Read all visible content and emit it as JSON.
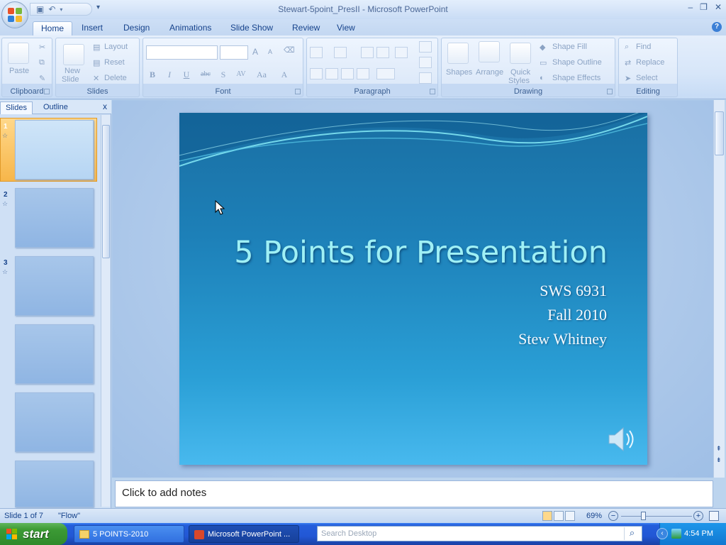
{
  "window": {
    "title": "Stewart-5point_PresII - Microsoft PowerPoint"
  },
  "tabs": [
    "Home",
    "Insert",
    "Design",
    "Animations",
    "Slide Show",
    "Review",
    "View"
  ],
  "ribbon": {
    "clipboard": {
      "title": "Clipboard",
      "paste": "Paste"
    },
    "slides": {
      "title": "Slides",
      "new_slide": "New",
      "new_slide2": "Slide",
      "layout": "Layout",
      "reset": "Reset",
      "delete": "Delete"
    },
    "font": {
      "title": "Font",
      "bold": "B",
      "italic": "I",
      "underline": "U",
      "strike": "abc",
      "shadow": "S",
      "spacing": "AV",
      "case": "Aa",
      "color": "A",
      "grow": "A",
      "shrink": "A"
    },
    "paragraph": {
      "title": "Paragraph"
    },
    "drawing": {
      "title": "Drawing",
      "shapes": "Shapes",
      "arrange": "Arrange",
      "quick_styles": "Quick",
      "quick_styles2": "Styles",
      "shape_fill": "Shape Fill",
      "shape_outline": "Shape Outline",
      "shape_effects": "Shape Effects"
    },
    "editing": {
      "title": "Editing",
      "find": "Find",
      "replace": "Replace",
      "select": "Select"
    }
  },
  "panel": {
    "tab_slides": "Slides",
    "tab_outline": "Outline",
    "close": "x",
    "thumbs": [
      "1",
      "2",
      "3"
    ]
  },
  "slide": {
    "title": "5 Points for Presentation",
    "lines": [
      "SWS 6931",
      "Fall 2010",
      "Stew Whitney"
    ]
  },
  "notes": {
    "placeholder": "Click to add notes"
  },
  "status": {
    "slide_info": "Slide 1 of 7",
    "theme": "\"Flow\"",
    "zoom": "69%"
  },
  "taskbar": {
    "start": "start",
    "tasks": [
      "5 POINTS-2010",
      "Microsoft PowerPoint ..."
    ],
    "search_placeholder": "Search Desktop",
    "clock": "4:54 PM"
  },
  "colors": {
    "ribbon_text": "#15428b",
    "slide_title": "#9ff0f5",
    "taskbar_blue": "#245edb",
    "start_green": "#3c9a35"
  }
}
